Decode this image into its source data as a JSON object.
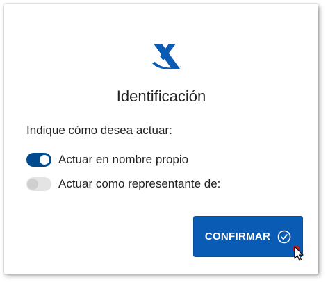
{
  "dialog": {
    "title": "Identificación",
    "prompt": "Indique cómo desea actuar:",
    "options": [
      {
        "label": "Actuar en nombre propio",
        "checked": true
      },
      {
        "label": "Actuar como representante de:",
        "checked": false
      }
    ],
    "confirm_label": "CONFIRMAR"
  },
  "icons": {
    "logo": "agency-logo-icon",
    "confirm": "check-circle-icon",
    "cursor": "mouse-pointer-icon"
  },
  "colors": {
    "accent": "#0a5bb3",
    "toggle_on": "#004b8d",
    "toggle_off": "#e4e4e4",
    "text": "#222222"
  }
}
